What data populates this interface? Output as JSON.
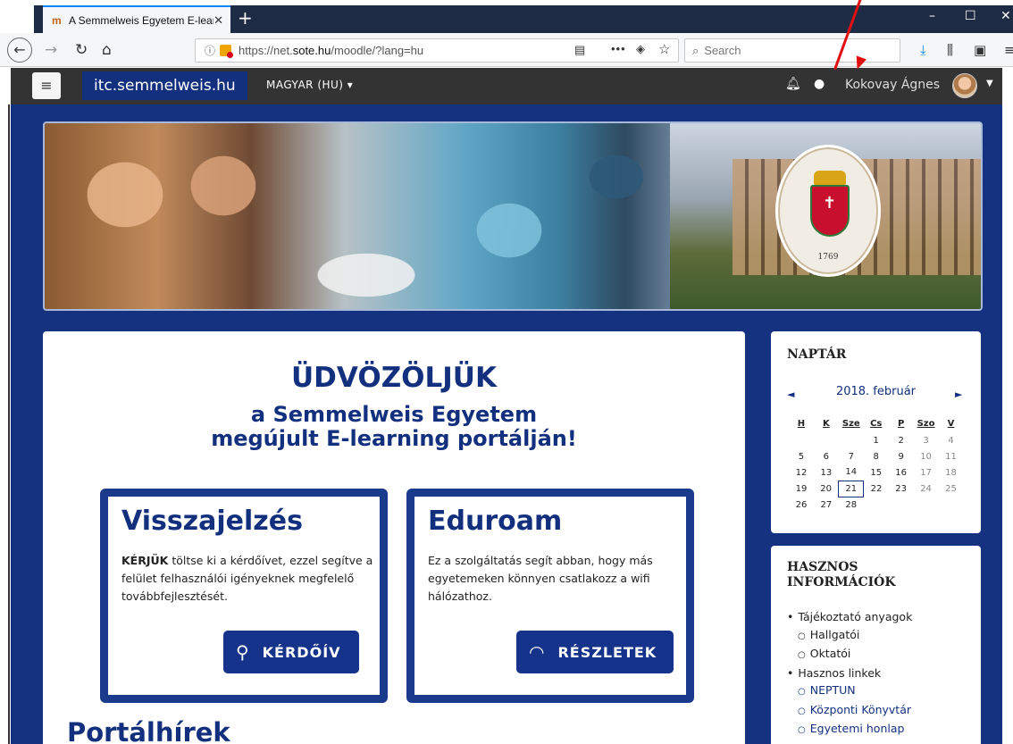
{
  "browser": {
    "tab_title": "A Semmelweis Egyetem E-learn",
    "tab_close": "✕",
    "new_tab": "+",
    "url_prefix": "https://net.",
    "url_domain": "sote.hu",
    "url_suffix": "/moodle/?lang=hu",
    "search_placeholder": "Search",
    "win_minimize": "–",
    "win_maximize": "☐",
    "win_close": "✕"
  },
  "header": {
    "menu_icon": "≡",
    "brand": "itc.semmelweis.hu",
    "language": "MAGYAR (HU)",
    "user_name": "Kokovay Ágnes"
  },
  "banner": {
    "seal_year": "1769"
  },
  "welcome": {
    "title": "ÜDVÖZÖLJÜK",
    "subtitle_line1": "a Semmelweis Egyetem",
    "subtitle_line2": "megújult E-learning portálján!"
  },
  "feedback": {
    "title": "Visszajelzés",
    "text_bold": "KÉRJÜK",
    "text": " töltse ki a kérdőívet, ezzel segítve a felület felhasználói igényeknek megfelelő továbbfejlesztését.",
    "button_label": "KÉRDŐÍV"
  },
  "eduroam": {
    "title": "Eduroam",
    "text": "Ez a szolgáltatás segít abban, hogy más egyetemeken könnyen csatlakozz a wifi hálózathoz.",
    "button_label": "RÉSZLETEK"
  },
  "news": {
    "title": "Portálhírek"
  },
  "calendar": {
    "title": "NAPTÁR",
    "month": "2018. február",
    "prev": "◄",
    "next": "►",
    "weekdays": [
      "H",
      "K",
      "Sze",
      "Cs",
      "P",
      "Szo",
      "V"
    ],
    "weeks": [
      [
        "",
        "",
        "",
        "1",
        "2",
        "3",
        "4"
      ],
      [
        "5",
        "6",
        "7",
        "8",
        "9",
        "10",
        "11"
      ],
      [
        "12",
        "13",
        "14",
        "15",
        "16",
        "17",
        "18"
      ],
      [
        "19",
        "20",
        "21",
        "22",
        "23",
        "24",
        "25"
      ],
      [
        "26",
        "27",
        "28",
        "",
        "",
        "",
        ""
      ]
    ],
    "today": "21"
  },
  "info": {
    "title": "HASZNOS INFORMÁCIÓK",
    "items": [
      {
        "label": "Tájékoztató anyagok",
        "level": 1,
        "link": false
      },
      {
        "label": "Hallgatói",
        "level": 2,
        "link": false
      },
      {
        "label": "Oktatói",
        "level": 2,
        "link": false
      },
      {
        "label": "Hasznos linkek",
        "level": 1,
        "link": false
      },
      {
        "label": "NEPTUN",
        "level": 2,
        "link": true
      },
      {
        "label": "Központi Könyvtár",
        "level": 2,
        "link": true
      },
      {
        "label": "Egyetemi honlap",
        "level": 2,
        "link": true
      }
    ]
  },
  "colors": {
    "primary": "#12307e",
    "page_background": "#14327f",
    "header_dark": "#333333",
    "annotation": "#e01010"
  }
}
